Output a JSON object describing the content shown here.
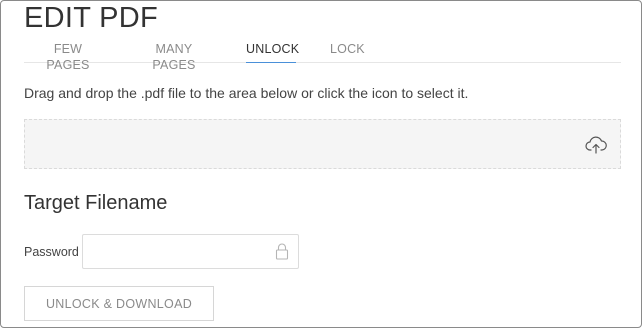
{
  "page": {
    "title": "EDIT PDF"
  },
  "tabs": [
    {
      "label": "FEW PAGES",
      "active": false
    },
    {
      "label": "MANY PAGES",
      "active": false
    },
    {
      "label": "UNLOCK",
      "active": true
    },
    {
      "label": "LOCK",
      "active": false
    }
  ],
  "dropzone": {
    "instructions": "Drag and drop the .pdf file to the area below or click the icon to select it.",
    "icon": "cloud-upload-icon"
  },
  "form": {
    "section_title": "Target Filename",
    "password_label": "Password",
    "password_value": "",
    "password_icon": "lock-icon"
  },
  "actions": {
    "unlock_download_label": "UNLOCK & DOWNLOAD"
  },
  "colors": {
    "active_tab_underline": "#4a90d9",
    "dropzone_background": "#f5f5f5",
    "text": "#333333",
    "muted_text": "#8a8a8a"
  }
}
